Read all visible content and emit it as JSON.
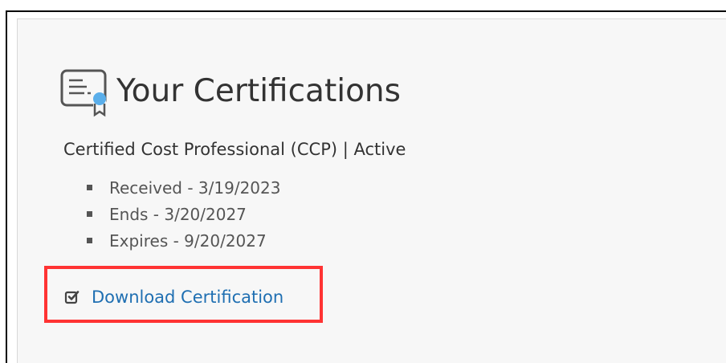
{
  "page": {
    "title": "Your Certifications",
    "accent_color": "#1f6fb2",
    "highlight_color": "#ff3333"
  },
  "certification": {
    "heading": "Certified Cost Professional (CCP) | Active",
    "details": [
      "Received - 3/19/2023",
      "Ends - 3/20/2027",
      "Expires - 9/20/2027"
    ],
    "download_label": "Download Certification",
    "download_icon": "check-square-icon",
    "title_icon": "certificate-icon"
  }
}
